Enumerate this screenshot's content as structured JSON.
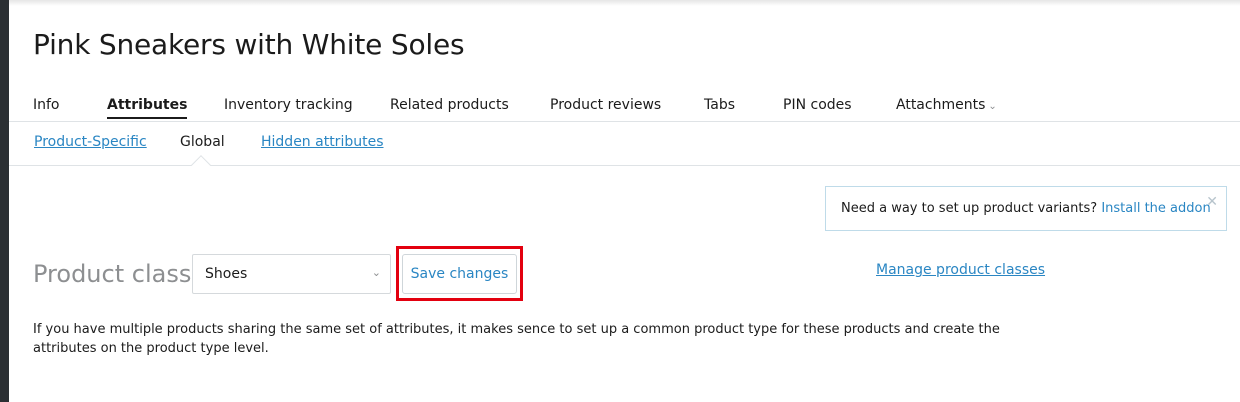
{
  "product": {
    "title": "Pink Sneakers with White Soles"
  },
  "tabs": [
    {
      "label": "Info"
    },
    {
      "label": "Attributes"
    },
    {
      "label": "Inventory tracking"
    },
    {
      "label": "Related products"
    },
    {
      "label": "Product reviews"
    },
    {
      "label": "Tabs"
    },
    {
      "label": "PIN codes"
    },
    {
      "label": "Attachments",
      "icon": "chevron-down-icon"
    }
  ],
  "active_tab": "Attributes",
  "subtabs": [
    {
      "label": "Product-Specific"
    },
    {
      "label": "Global"
    },
    {
      "label": "Hidden attributes"
    }
  ],
  "active_subtab": "Global",
  "notice": {
    "text": "Need a way to set up product variants?",
    "link": "Install the addon",
    "close_icon": "close-icon"
  },
  "product_class": {
    "label": "Product class:",
    "selected": "Shoes",
    "save_label": "Save changes",
    "manage_link": "Manage product classes"
  },
  "help_text": "If you have multiple products sharing the same set of attributes, it makes sence to set up a common product type for these products and create the attributes on the product type level.",
  "colors": {
    "link": "#2a86c3",
    "highlight": "#e3000f",
    "label_gray": "#8d8f91"
  }
}
